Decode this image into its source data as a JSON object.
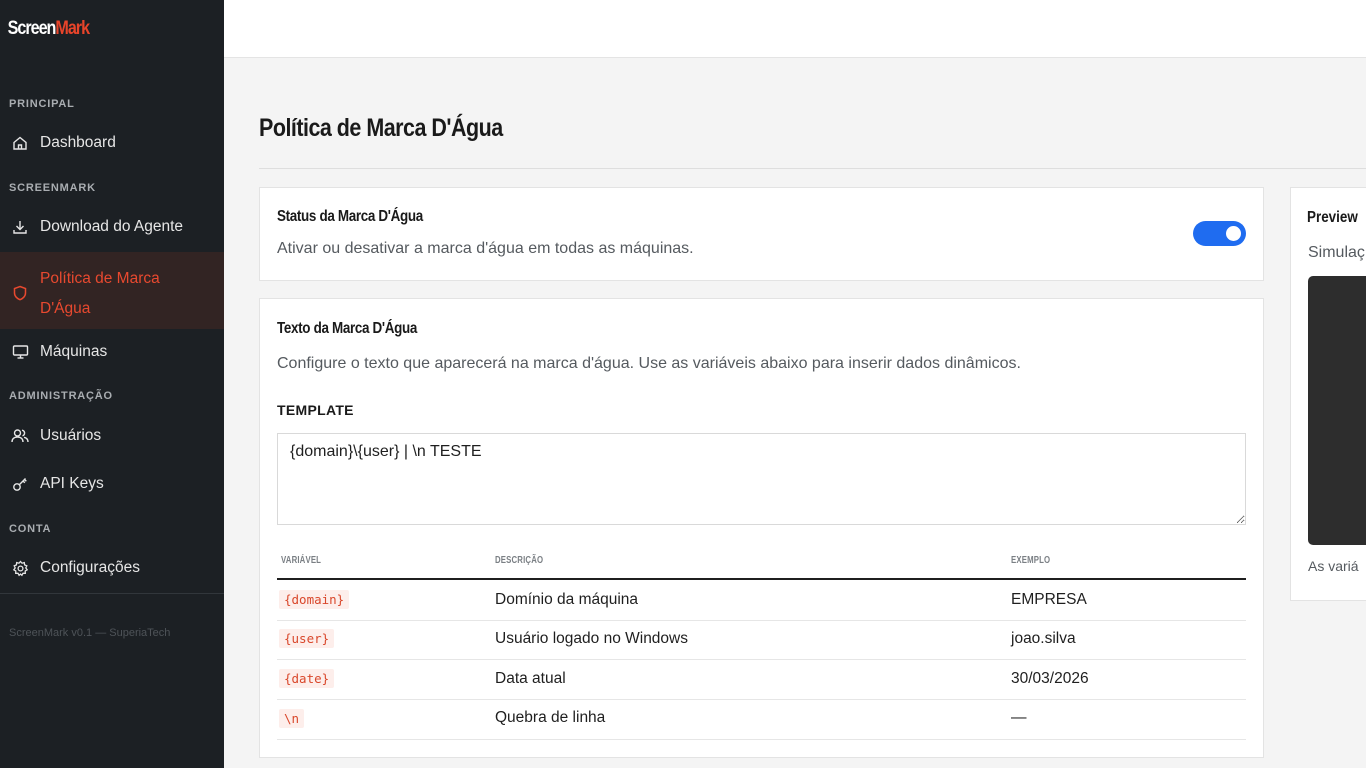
{
  "app": {
    "logo_part1": "Screen",
    "logo_part2": "Mark",
    "brand_color": "#e8442a",
    "version": "ScreenMark v0.1 — SuperiaTech"
  },
  "sidebar": {
    "sections": [
      {
        "label": "PRINCIPAL"
      },
      {
        "label": "SCREENMARK"
      },
      {
        "label": "ADMINISTRAÇÃO"
      },
      {
        "label": "CONTA"
      }
    ],
    "items": [
      {
        "label": "Dashboard",
        "icon": "home-icon"
      },
      {
        "label": "Download do Agente",
        "icon": "download-icon"
      },
      {
        "label_line1": "Política de Marca",
        "label_line2": "D'Água",
        "icon": "shield-icon",
        "active": true
      },
      {
        "label": "Máquinas",
        "icon": "monitor-icon"
      },
      {
        "label": "Usuários",
        "icon": "users-icon"
      },
      {
        "label": "API Keys",
        "icon": "key-icon"
      },
      {
        "label": "Configurações",
        "icon": "gear-icon"
      }
    ]
  },
  "page": {
    "title": "Política de Marca D'Água"
  },
  "status_card": {
    "title": "Status da Marca D'Água",
    "description": "Ativar ou desativar a marca d'água em todas as máquinas.",
    "enabled": true,
    "toggle_color": "#1f6cf0"
  },
  "text_card": {
    "title": "Texto da Marca D'Água",
    "description": "Configure o texto que aparecerá na marca d'água. Use as variáveis abaixo para inserir dados dinâmicos.",
    "template_label": "TEMPLATE",
    "template_value": "{domain}\\{user} | \\n TESTE",
    "table": {
      "headers": [
        "VARIÁVEL",
        "DESCRIÇÃO",
        "EXEMPLO"
      ],
      "rows": [
        {
          "variable": "{domain}",
          "description": "Domínio da máquina",
          "example": "EMPRESA"
        },
        {
          "variable": "{user}",
          "description": "Usuário logado no Windows",
          "example": "joao.silva"
        },
        {
          "variable": "{date}",
          "description": "Data atual",
          "example": "30/03/2026"
        },
        {
          "variable": "\\n",
          "description": "Quebra de linha",
          "example": "—"
        }
      ]
    }
  },
  "preview_card": {
    "title": "Preview",
    "subtitle": "Simulaç",
    "footer": "As variá"
  }
}
